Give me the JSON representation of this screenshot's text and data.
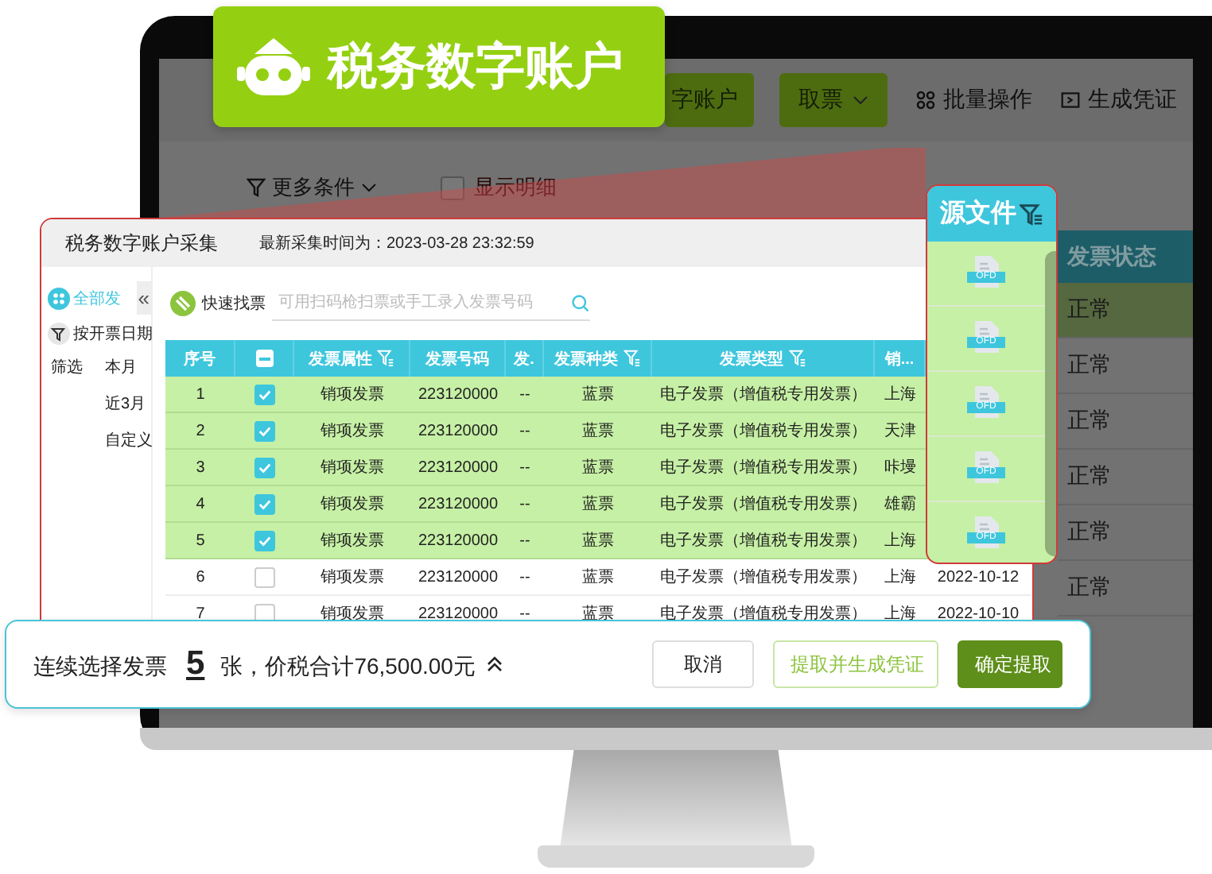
{
  "logo": {
    "title": "税务数字账户"
  },
  "background_app": {
    "toolbar": [
      {
        "label": "字账户",
        "kind": "button"
      },
      {
        "label": "取票",
        "kind": "dropdown"
      },
      {
        "label": "批量操作",
        "kind": "batch"
      },
      {
        "label": "生成凭证",
        "kind": "voucher"
      }
    ],
    "more_filters": "更多条件",
    "show_detail": {
      "label": "显示明细",
      "checked": false
    },
    "status_column": {
      "header": "发票状态",
      "rows": [
        {
          "value": "正常",
          "selected": true
        },
        {
          "value": "正常",
          "selected": false
        },
        {
          "value": "正常",
          "selected": false
        },
        {
          "value": "正常",
          "selected": false
        },
        {
          "value": "正常",
          "selected": false
        },
        {
          "value": "正常",
          "selected": false
        }
      ]
    }
  },
  "panel": {
    "title": "税务数字账户采集",
    "last_collected": "最新采集时间为：2023-03-28 23:32:59",
    "sidebar": {
      "all": "全部发",
      "collapse": "«",
      "by_date": "按开票日期",
      "filter_label": "筛选",
      "options": [
        "本月",
        "近3月",
        "自定义"
      ]
    },
    "search": {
      "label": "快速找票",
      "placeholder": "可用扫码枪扫票或手工录入发票号码"
    },
    "table": {
      "columns": [
        {
          "label": "序号",
          "kind": "text",
          "filterable": false
        },
        {
          "kind": "checkbox",
          "partial": true
        },
        {
          "label": "发票属性",
          "kind": "text",
          "filterable": true
        },
        {
          "label": "发票号码",
          "kind": "text",
          "filterable": false
        },
        {
          "label": "发.",
          "kind": "text",
          "filterable": false
        },
        {
          "label": "发票种类",
          "kind": "text",
          "filterable": true
        },
        {
          "label": "发票类型",
          "kind": "text",
          "filterable": true
        },
        {
          "label": "销...",
          "kind": "text",
          "filterable": false
        }
      ],
      "rows": [
        {
          "index": "1",
          "checked": true,
          "attribute": "销项发票",
          "number": "223120000",
          "col_5": "--",
          "category": "蓝票",
          "type": "电子发票（增值税专用发票）",
          "seller": "上海"
        },
        {
          "index": "2",
          "checked": true,
          "attribute": "销项发票",
          "number": "223120000",
          "col_5": "--",
          "category": "蓝票",
          "type": "电子发票（增值税专用发票）",
          "seller": "天津"
        },
        {
          "index": "3",
          "checked": true,
          "attribute": "销项发票",
          "number": "223120000",
          "col_5": "--",
          "category": "蓝票",
          "type": "电子发票（增值税专用发票）",
          "seller": "咔墁"
        },
        {
          "index": "4",
          "checked": true,
          "attribute": "销项发票",
          "number": "223120000",
          "col_5": "--",
          "category": "蓝票",
          "type": "电子发票（增值税专用发票）",
          "seller": "雄霸"
        },
        {
          "index": "5",
          "checked": true,
          "attribute": "销项发票",
          "number": "223120000",
          "col_5": "--",
          "category": "蓝票",
          "type": "电子发票（增值税专用发票）",
          "seller": "上海"
        },
        {
          "index": "6",
          "checked": false,
          "attribute": "销项发票",
          "number": "223120000",
          "col_5": "--",
          "category": "蓝票",
          "type": "电子发票（增值税专用发票）",
          "seller": "上海",
          "date": "2022-10-12"
        },
        {
          "index": "7",
          "checked": false,
          "attribute": "销项发票",
          "number": "223120000",
          "col_5": "--",
          "category": "蓝票",
          "type": "电子发票（增值税专用发票）",
          "seller": "上海",
          "date": "2022-10-10"
        }
      ]
    }
  },
  "source_files": {
    "title": "源文件",
    "files": [
      {
        "label": "OFD"
      },
      {
        "label": "OFD"
      },
      {
        "label": "OFD"
      },
      {
        "label": "OFD"
      },
      {
        "label": "OFD"
      }
    ]
  },
  "summary_bar": {
    "prefix": "连续选择发票",
    "count": "5",
    "suffix": "张，价税合计76,500.00元",
    "buttons": [
      {
        "label": "取消",
        "kind": "default"
      },
      {
        "label": "提取并生成凭证",
        "kind": "outline"
      },
      {
        "label": "确定提取",
        "kind": "primary"
      }
    ]
  }
}
